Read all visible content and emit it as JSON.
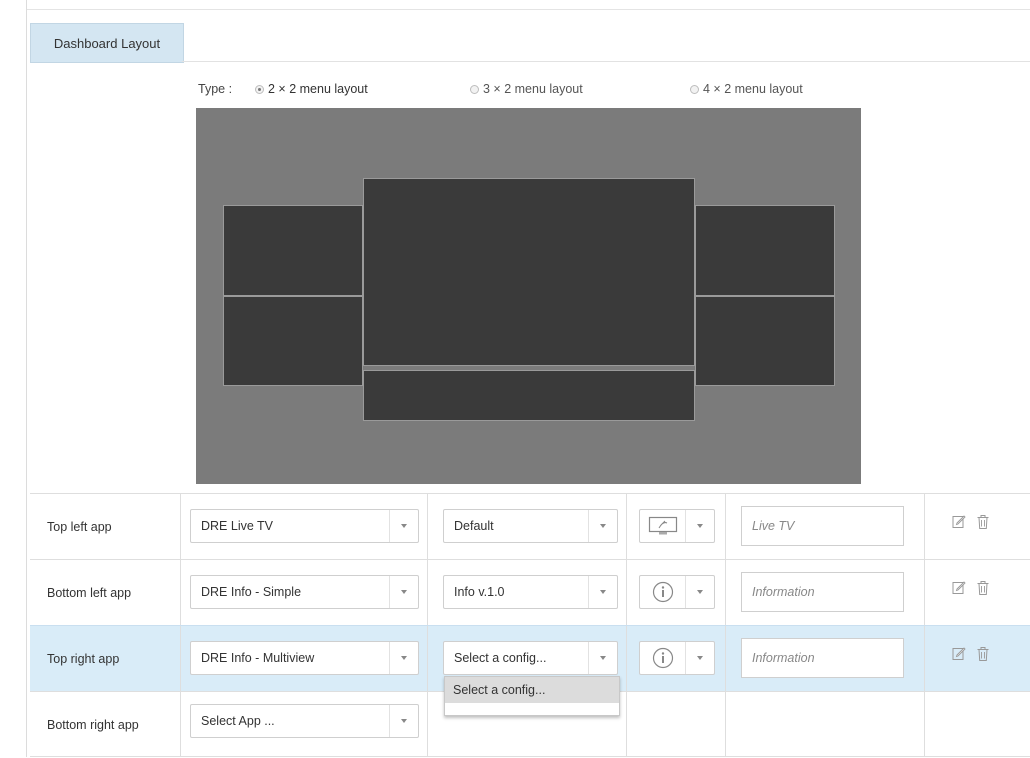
{
  "tab": {
    "label": "Dashboard Layout"
  },
  "layout_type": {
    "label": "Type :",
    "options": [
      {
        "label": "2 × 2 menu layout",
        "checked": true
      },
      {
        "label": "3 × 2 menu layout",
        "checked": false
      },
      {
        "label": "4 × 2 menu layout",
        "checked": false
      }
    ]
  },
  "rows": [
    {
      "label": "Top left app",
      "app": "DRE Live TV",
      "config": "Default",
      "icon": "tv-icon",
      "title_value": "",
      "title_placeholder": "Live TV"
    },
    {
      "label": "Bottom left app",
      "app": "DRE Info - Simple",
      "config": "Info v.1.0",
      "icon": "info-icon",
      "title_value": "",
      "title_placeholder": "Information"
    },
    {
      "label": "Top right app",
      "app": "DRE Info - Multiview",
      "config": "Select a config...",
      "icon": "info-icon",
      "title_value": "",
      "title_placeholder": "Information"
    },
    {
      "label": "Bottom right app",
      "app": "Select App ..."
    }
  ],
  "config_dropdown": {
    "options": [
      "Select a config..."
    ]
  },
  "colors": {
    "tab_bg": "#d4e6f2",
    "selected_row_bg": "#d9ecf8",
    "preview_bg": "#7b7b7b",
    "tile_bg": "#3a3a3a"
  }
}
